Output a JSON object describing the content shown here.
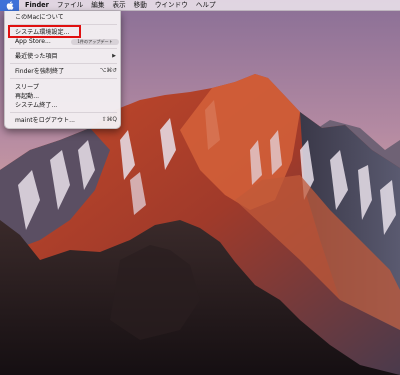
{
  "menubar": {
    "apple_icon": "apple-logo-icon",
    "items": [
      "Finder",
      "ファイル",
      "編集",
      "表示",
      "移動",
      "ウインドウ",
      "ヘルプ"
    ]
  },
  "apple_menu": {
    "about": "このMacについて",
    "system_prefs": "システム環境設定...",
    "app_store": "App Store...",
    "app_store_badge": "1件のアップデート",
    "recent_items": "最近使った項目",
    "force_quit": "Finderを強制終了",
    "force_quit_shortcut": "⌥⌘↺",
    "sleep": "スリープ",
    "restart": "再起動...",
    "shutdown": "システム終了...",
    "logout": "maintをログアウト...",
    "logout_shortcut": "⇧⌘Q"
  },
  "colors": {
    "apple_highlight": "#3e71d8",
    "annotation_red": "#e01010"
  }
}
